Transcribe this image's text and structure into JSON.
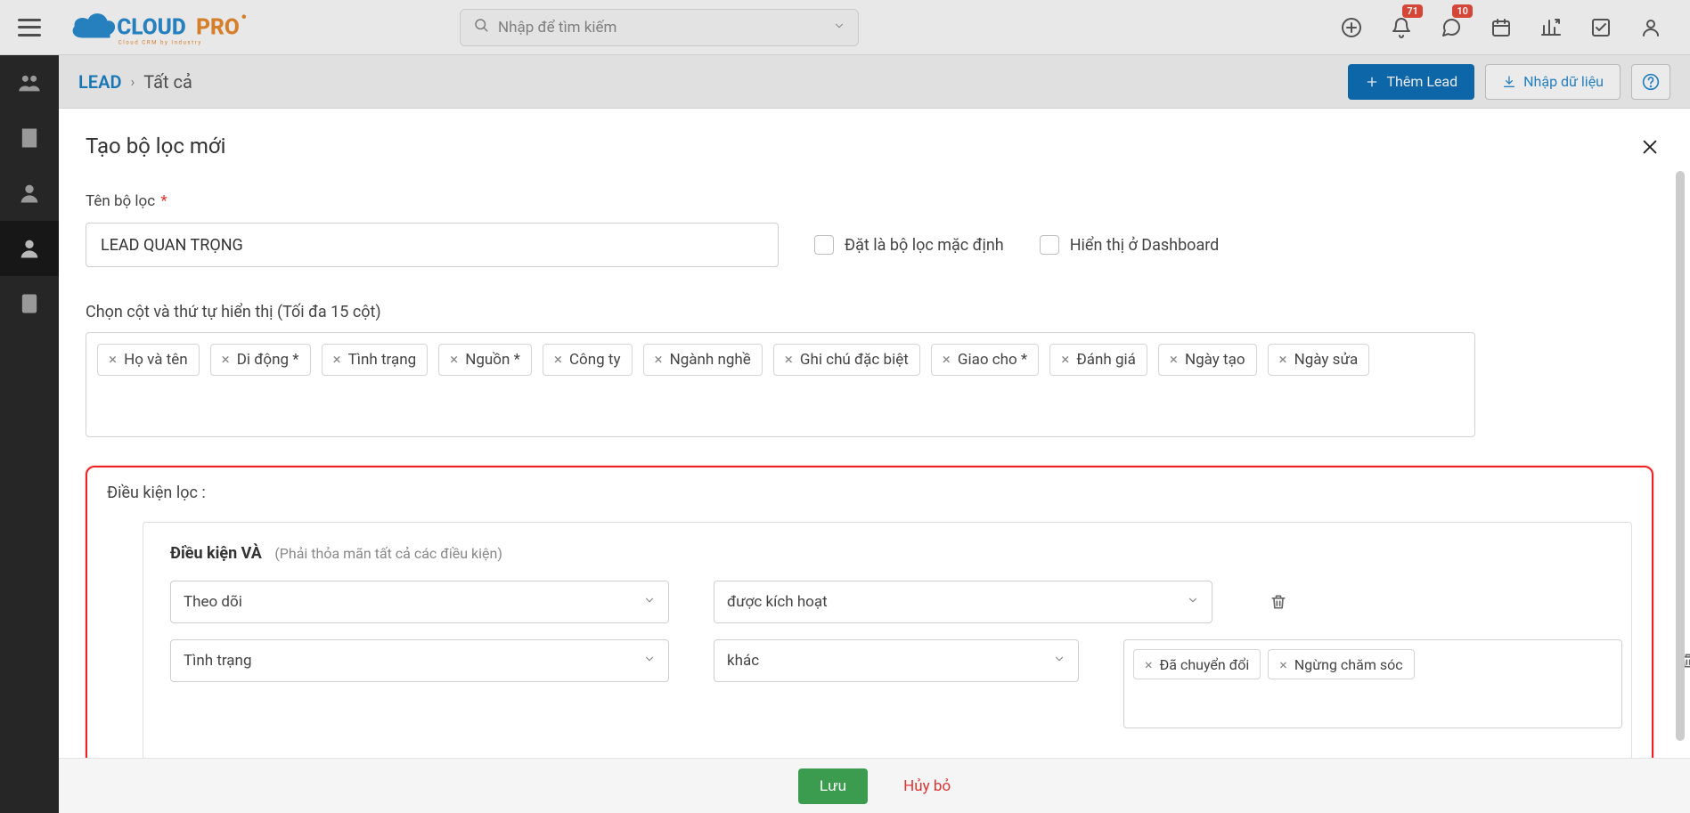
{
  "topbar": {
    "search_placeholder": "Nhập để tìm kiếm",
    "badges": {
      "notifications": "71",
      "messages": "10"
    }
  },
  "breadcrumb": {
    "root": "LEAD",
    "leaf": "Tất cả"
  },
  "actions": {
    "add_lead": "Thêm Lead",
    "import": "Nhập dữ liệu"
  },
  "panel": {
    "title": "Tạo bộ lọc mới",
    "filter_name_label": "Tên bộ lọc",
    "filter_name_value": "LEAD QUAN TRỌNG",
    "default_checkbox": "Đặt là bộ lọc mặc định",
    "dashboard_checkbox": "Hiển thị ở Dashboard",
    "columns_label": "Chọn cột và thứ tự hiển thị (Tối đa 15 cột)",
    "columns": [
      "Họ và tên",
      "Di động *",
      "Tình trạng",
      "Nguồn *",
      "Công ty",
      "Ngành nghề",
      "Ghi chú đặc biệt",
      "Giao cho *",
      "Đánh giá",
      "Ngày tạo",
      "Ngày sửa"
    ],
    "cond_title": "Điều kiện lọc :",
    "cond_head_bold": "Điều kiện VÀ",
    "cond_head_note": "(Phải thỏa mãn tất cả các điều kiện)",
    "rows": [
      {
        "field": "Theo dõi",
        "op": "được kích hoạt",
        "values": []
      },
      {
        "field": "Tình trạng",
        "op": "khác",
        "values": [
          "Đã chuyển đổi",
          "Ngừng chăm sóc"
        ]
      }
    ]
  },
  "footer": {
    "save": "Lưu",
    "cancel": "Hủy bỏ"
  }
}
